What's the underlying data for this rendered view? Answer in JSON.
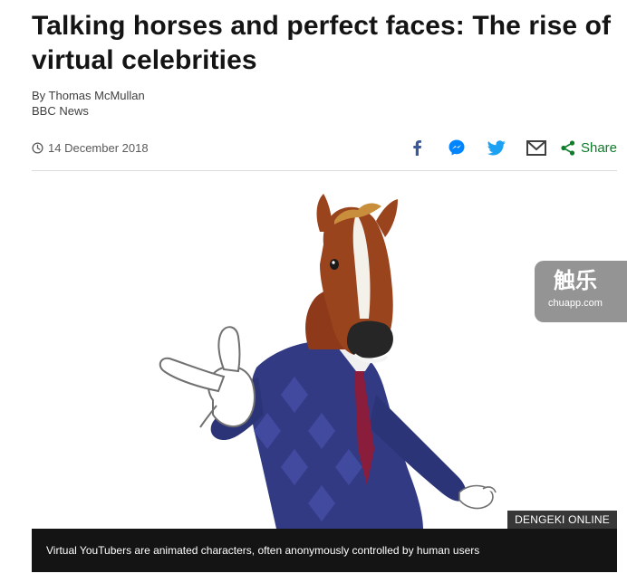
{
  "article": {
    "headline": "Talking horses and perfect faces: The rise of virtual celebrities",
    "byline": "By Thomas McMullan",
    "source": "BBC News",
    "date": "14 December 2018"
  },
  "share": {
    "icons": [
      "facebook-icon",
      "messenger-icon",
      "twitter-icon",
      "email-icon",
      "share-icon"
    ],
    "label": "Share"
  },
  "figure": {
    "credit": "DENGEKI ONLINE",
    "caption": "Virtual YouTubers are animated characters, often anonymously controlled by human users"
  },
  "watermark": {
    "title": "触乐",
    "subtitle": "chuapp.com"
  },
  "colors": {
    "headline": "#141414",
    "facebook": "#3b5998",
    "messenger": "#0084ff",
    "twitter": "#1da1f2",
    "share": "#0e7c2a",
    "caption_bg": "#141414"
  }
}
